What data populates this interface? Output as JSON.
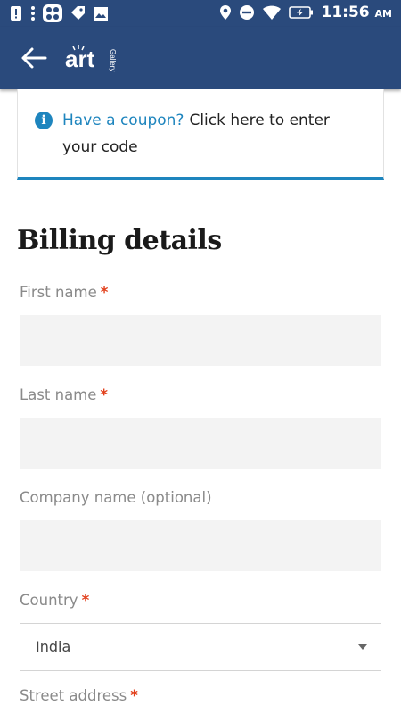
{
  "status_bar": {
    "time": "11:56",
    "ampm": "AM",
    "icons": [
      "alert-icon",
      "dots-app-icon",
      "tag-icon",
      "gallery-icon",
      "location-icon",
      "do-not-disturb-icon",
      "wifi-icon",
      "battery-charging-icon"
    ]
  },
  "app_bar": {
    "back_icon": "arrow-left-icon",
    "logo_text": "art",
    "logo_subtext": "Gallery",
    "background": "#2a4a7c"
  },
  "coupon": {
    "link_text": "Have a coupon?",
    "cta_text": "Click here to enter your code",
    "accent": "#1e85be"
  },
  "billing": {
    "title": "Billing details",
    "required_marker": "*",
    "fields": {
      "first_name": {
        "label": "First name",
        "value": ""
      },
      "last_name": {
        "label": "Last name",
        "value": ""
      },
      "company": {
        "label": "Company name (optional)",
        "value": ""
      },
      "country": {
        "label": "Country",
        "value": "India"
      },
      "street": {
        "label": "Street address"
      }
    }
  }
}
